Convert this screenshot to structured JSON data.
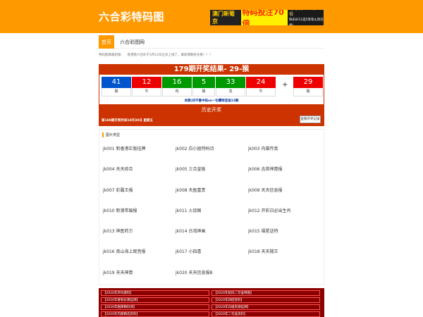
{
  "header": {
    "logo": "六合彩特码图",
    "ad": {
      "left": "澳门新葡京",
      "highlight": "特码投注70倍",
      "right": "时时彩/PK10/9.9倍",
      "sub": "快乐8/11选5等等火热在线!"
    }
  },
  "nav": {
    "items": [
      "首页",
      "六合彩图网"
    ]
  },
  "notice": {
    "label": "特码图库最新版:",
    "text": "香港香六合彩于5月12日正式上线了，最新期数抢先看！！！"
  },
  "result": {
    "title": "179期开奖结果- 29-猴",
    "balls": [
      {
        "number": "41",
        "zodiac": "猴",
        "color": "blue"
      },
      {
        "number": "12",
        "zodiac": "牛",
        "color": "red"
      },
      {
        "number": "16",
        "zodiac": "鸡",
        "color": "green"
      },
      {
        "number": "5",
        "zodiac": "猴",
        "color": "green"
      },
      {
        "number": "33",
        "zodiac": "龙",
        "color": "green"
      },
      {
        "number": "24",
        "zodiac": "牛",
        "color": "red"
      }
    ],
    "plus": "+",
    "special": {
      "number": "29",
      "zodiac": "猴",
      "color": "red"
    },
    "note": "本期:四不像中码vs一句爆特连准13期",
    "history_title": "历史开奖",
    "next_draw": "第180期开奖时间10月30日 星期五",
    "history_button": "查看开奖记录"
  },
  "images": {
    "heading": "图片类型",
    "rows": [
      [
        "jk001 新香港正版挂牌",
        "jk002 白小姐特码诗",
        "jk003 内幕传真"
      ],
      [
        "jk004 天天综合",
        "jk005 三合皇板",
        "jk006 吉首神算报"
      ],
      [
        "jk007 彩霸王报",
        "jk008 天盈富贵",
        "jk009 天天信息报"
      ],
      [
        "jk010 新澳带眉报",
        "jk011 火烧图",
        "jk012 开彩日必出生肖"
      ],
      [
        "jk013 神医药方",
        "jk014 台湾神画",
        "jk015 福星送特"
      ],
      [
        "jk016 南山海上观音报",
        "jk017 小四喜",
        "jk018 天天隨王"
      ],
      [
        "jk019 天天神算",
        "jk020 天天信息报B",
        ""
      ]
    ]
  },
  "links": {
    "items": [
      "【2020年开码資料】",
      "【2020年抢码二句准特图】",
      "【2020年春秋彩資挂牌】",
      "【2020年四招资料】",
      "【2020年图库精码诗】",
      "【2020年白姐资源挂牌】",
      "【2020年内部精选资料】",
      "【2020年二句准资料】"
    ]
  }
}
